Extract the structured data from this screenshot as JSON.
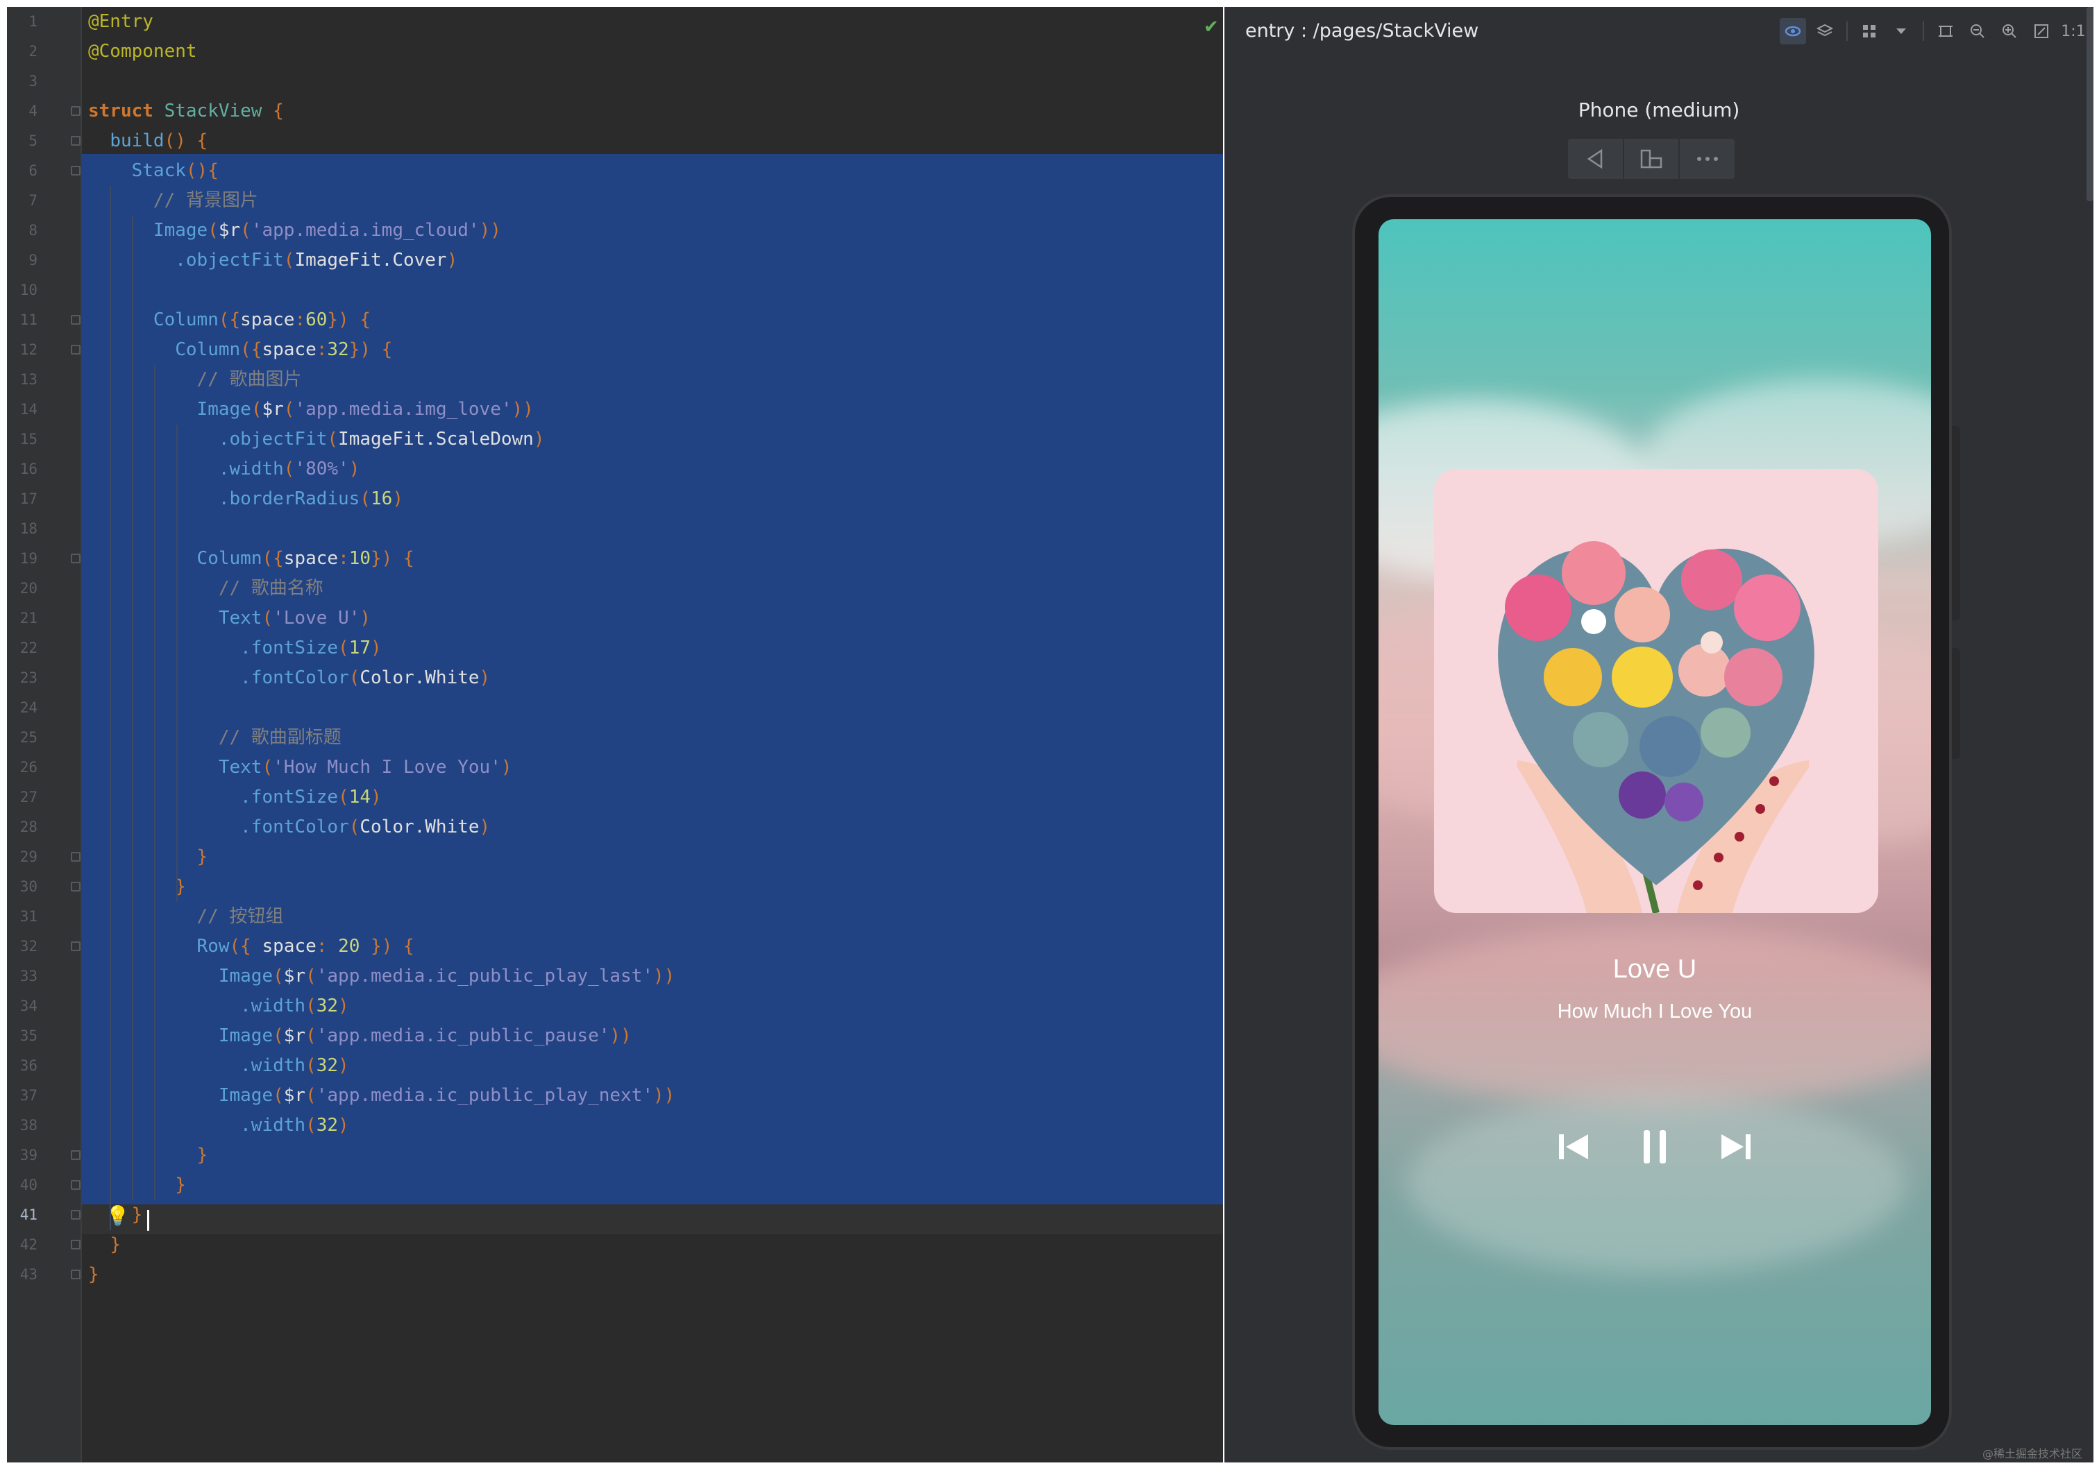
{
  "editor": {
    "lines": [
      {
        "n": "1",
        "t": [
          [
            "c-ann",
            "@Entry"
          ]
        ]
      },
      {
        "n": "2",
        "t": [
          [
            "c-ann",
            "@Component"
          ]
        ]
      },
      {
        "n": "3",
        "t": []
      },
      {
        "n": "4",
        "t": [
          [
            "c-kw",
            "struct "
          ],
          [
            "c-type",
            "StackView "
          ],
          [
            "c-brace",
            "{"
          ]
        ]
      },
      {
        "n": "5",
        "t": [
          [
            "",
            "  "
          ],
          [
            "c-fn",
            "build"
          ],
          [
            "c-brace",
            "() {"
          ]
        ]
      },
      {
        "n": "6",
        "t": [
          [
            "",
            "    "
          ],
          [
            "c-fn",
            "Stack"
          ],
          [
            "c-brace",
            "(){"
          ]
        ]
      },
      {
        "n": "7",
        "t": [
          [
            "",
            "      "
          ],
          [
            "c-cm",
            "// 背景图片"
          ]
        ]
      },
      {
        "n": "8",
        "t": [
          [
            "",
            "      "
          ],
          [
            "c-fn",
            "Image"
          ],
          [
            "c-brace",
            "("
          ],
          [
            "c-id",
            "$r"
          ],
          [
            "c-brace",
            "("
          ],
          [
            "c-str",
            "'app.media.img_cloud'"
          ],
          [
            "c-brace",
            "))"
          ]
        ]
      },
      {
        "n": "9",
        "t": [
          [
            "",
            "        "
          ],
          [
            "c-meth",
            ".objectFit"
          ],
          [
            "c-brace",
            "("
          ],
          [
            "c-id",
            "ImageFit.Cover"
          ],
          [
            "c-brace",
            ")"
          ]
        ]
      },
      {
        "n": "10",
        "t": []
      },
      {
        "n": "11",
        "t": [
          [
            "",
            "      "
          ],
          [
            "c-fn",
            "Column"
          ],
          [
            "c-brace",
            "({"
          ],
          [
            "c-id",
            "space"
          ],
          [
            "c-brace",
            ":"
          ],
          [
            "c-num",
            "60"
          ],
          [
            "c-brace",
            "}) {"
          ]
        ]
      },
      {
        "n": "12",
        "t": [
          [
            "",
            "        "
          ],
          [
            "c-fn",
            "Column"
          ],
          [
            "c-brace",
            "({"
          ],
          [
            "c-id",
            "space"
          ],
          [
            "c-brace",
            ":"
          ],
          [
            "c-num",
            "32"
          ],
          [
            "c-brace",
            "}) {"
          ]
        ]
      },
      {
        "n": "13",
        "t": [
          [
            "",
            "          "
          ],
          [
            "c-cm",
            "// 歌曲图片"
          ]
        ]
      },
      {
        "n": "14",
        "t": [
          [
            "",
            "          "
          ],
          [
            "c-fn",
            "Image"
          ],
          [
            "c-brace",
            "("
          ],
          [
            "c-id",
            "$r"
          ],
          [
            "c-brace",
            "("
          ],
          [
            "c-str",
            "'app.media.img_love'"
          ],
          [
            "c-brace",
            "))"
          ]
        ]
      },
      {
        "n": "15",
        "t": [
          [
            "",
            "            "
          ],
          [
            "c-meth",
            ".objectFit"
          ],
          [
            "c-brace",
            "("
          ],
          [
            "c-id",
            "ImageFit.ScaleDown"
          ],
          [
            "c-brace",
            ")"
          ]
        ]
      },
      {
        "n": "16",
        "t": [
          [
            "",
            "            "
          ],
          [
            "c-meth",
            ".width"
          ],
          [
            "c-brace",
            "("
          ],
          [
            "c-str",
            "'80%'"
          ],
          [
            "c-brace",
            ")"
          ]
        ]
      },
      {
        "n": "17",
        "t": [
          [
            "",
            "            "
          ],
          [
            "c-meth",
            ".borderRadius"
          ],
          [
            "c-brace",
            "("
          ],
          [
            "c-num",
            "16"
          ],
          [
            "c-brace",
            ")"
          ]
        ]
      },
      {
        "n": "18",
        "t": []
      },
      {
        "n": "19",
        "t": [
          [
            "",
            "          "
          ],
          [
            "c-fn",
            "Column"
          ],
          [
            "c-brace",
            "({"
          ],
          [
            "c-id",
            "space"
          ],
          [
            "c-brace",
            ":"
          ],
          [
            "c-num",
            "10"
          ],
          [
            "c-brace",
            "}) {"
          ]
        ]
      },
      {
        "n": "20",
        "t": [
          [
            "",
            "            "
          ],
          [
            "c-cm",
            "// 歌曲名称"
          ]
        ]
      },
      {
        "n": "21",
        "t": [
          [
            "",
            "            "
          ],
          [
            "c-fn",
            "Text"
          ],
          [
            "c-brace",
            "("
          ],
          [
            "c-str",
            "'Love U'"
          ],
          [
            "c-brace",
            ")"
          ]
        ]
      },
      {
        "n": "22",
        "t": [
          [
            "",
            "              "
          ],
          [
            "c-meth",
            ".fontSize"
          ],
          [
            "c-brace",
            "("
          ],
          [
            "c-num",
            "17"
          ],
          [
            "c-brace",
            ")"
          ]
        ]
      },
      {
        "n": "23",
        "t": [
          [
            "",
            "              "
          ],
          [
            "c-meth",
            ".fontColor"
          ],
          [
            "c-brace",
            "("
          ],
          [
            "c-id",
            "Color.White"
          ],
          [
            "c-brace",
            ")"
          ]
        ]
      },
      {
        "n": "24",
        "t": []
      },
      {
        "n": "25",
        "t": [
          [
            "",
            "            "
          ],
          [
            "c-cm",
            "// 歌曲副标题"
          ]
        ]
      },
      {
        "n": "26",
        "t": [
          [
            "",
            "            "
          ],
          [
            "c-fn",
            "Text"
          ],
          [
            "c-brace",
            "("
          ],
          [
            "c-str",
            "'How Much I Love You'"
          ],
          [
            "c-brace",
            ")"
          ]
        ]
      },
      {
        "n": "27",
        "t": [
          [
            "",
            "              "
          ],
          [
            "c-meth",
            ".fontSize"
          ],
          [
            "c-brace",
            "("
          ],
          [
            "c-num",
            "14"
          ],
          [
            "c-brace",
            ")"
          ]
        ]
      },
      {
        "n": "28",
        "t": [
          [
            "",
            "              "
          ],
          [
            "c-meth",
            ".fontColor"
          ],
          [
            "c-brace",
            "("
          ],
          [
            "c-id",
            "Color.White"
          ],
          [
            "c-brace",
            ")"
          ]
        ]
      },
      {
        "n": "29",
        "t": [
          [
            "",
            "          "
          ],
          [
            "c-brace",
            "}"
          ]
        ]
      },
      {
        "n": "30",
        "t": [
          [
            "",
            "        "
          ],
          [
            "c-brace",
            "}"
          ]
        ]
      },
      {
        "n": "31",
        "t": [
          [
            "",
            "          "
          ],
          [
            "c-cm",
            "// 按钮组"
          ]
        ]
      },
      {
        "n": "32",
        "t": [
          [
            "",
            "          "
          ],
          [
            "c-fn",
            "Row"
          ],
          [
            "c-brace",
            "({ "
          ],
          [
            "c-id",
            "space"
          ],
          [
            "c-brace",
            ": "
          ],
          [
            "c-num",
            "20"
          ],
          [
            "c-brace",
            " }) {"
          ]
        ]
      },
      {
        "n": "33",
        "t": [
          [
            "",
            "            "
          ],
          [
            "c-fn",
            "Image"
          ],
          [
            "c-brace",
            "("
          ],
          [
            "c-id",
            "$r"
          ],
          [
            "c-brace",
            "("
          ],
          [
            "c-str",
            "'app.media.ic_public_play_last'"
          ],
          [
            "c-brace",
            "))"
          ]
        ]
      },
      {
        "n": "34",
        "t": [
          [
            "",
            "              "
          ],
          [
            "c-meth",
            ".width"
          ],
          [
            "c-brace",
            "("
          ],
          [
            "c-num",
            "32"
          ],
          [
            "c-brace",
            ")"
          ]
        ]
      },
      {
        "n": "35",
        "t": [
          [
            "",
            "            "
          ],
          [
            "c-fn",
            "Image"
          ],
          [
            "c-brace",
            "("
          ],
          [
            "c-id",
            "$r"
          ],
          [
            "c-brace",
            "("
          ],
          [
            "c-str",
            "'app.media.ic_public_pause'"
          ],
          [
            "c-brace",
            "))"
          ]
        ]
      },
      {
        "n": "36",
        "t": [
          [
            "",
            "              "
          ],
          [
            "c-meth",
            ".width"
          ],
          [
            "c-brace",
            "("
          ],
          [
            "c-num",
            "32"
          ],
          [
            "c-brace",
            ")"
          ]
        ]
      },
      {
        "n": "37",
        "t": [
          [
            "",
            "            "
          ],
          [
            "c-fn",
            "Image"
          ],
          [
            "c-brace",
            "("
          ],
          [
            "c-id",
            "$r"
          ],
          [
            "c-brace",
            "("
          ],
          [
            "c-str",
            "'app.media.ic_public_play_next'"
          ],
          [
            "c-brace",
            "))"
          ]
        ]
      },
      {
        "n": "38",
        "t": [
          [
            "",
            "              "
          ],
          [
            "c-meth",
            ".width"
          ],
          [
            "c-brace",
            "("
          ],
          [
            "c-num",
            "32"
          ],
          [
            "c-brace",
            ")"
          ]
        ]
      },
      {
        "n": "39",
        "t": [
          [
            "",
            "          "
          ],
          [
            "c-brace",
            "}"
          ]
        ]
      },
      {
        "n": "40",
        "t": [
          [
            "",
            "        "
          ],
          [
            "c-brace",
            "}"
          ]
        ]
      },
      {
        "n": "41",
        "t": [
          [
            "",
            "    "
          ],
          [
            "c-brace",
            "}"
          ]
        ]
      },
      {
        "n": "42",
        "t": [
          [
            "",
            "  "
          ],
          [
            "c-brace",
            "}"
          ]
        ]
      },
      {
        "n": "43",
        "t": [
          [
            "c-brace",
            "}"
          ]
        ]
      }
    ],
    "current_line": "41",
    "status_icon": "checkmark-icon"
  },
  "preview": {
    "title": "entry : /pages/StackView",
    "device_name": "Phone (medium)",
    "toolbar_icons": [
      "eye-icon",
      "layers-icon",
      "grid-icon",
      "dropdown-icon",
      "frame-icon",
      "zoom-out-icon",
      "zoom-in-icon",
      "fit-icon",
      "actual-size-icon"
    ],
    "toolbar_actual_size": "1:1",
    "device_controls": [
      "back-icon",
      "rotate-icon",
      "more-icon"
    ],
    "song_title": "Love U",
    "song_subtitle": "How Much I Love You",
    "player_controls": [
      "play-last-icon",
      "pause-icon",
      "play-next-icon"
    ],
    "watermark": "@稀土掘金技术社区"
  }
}
